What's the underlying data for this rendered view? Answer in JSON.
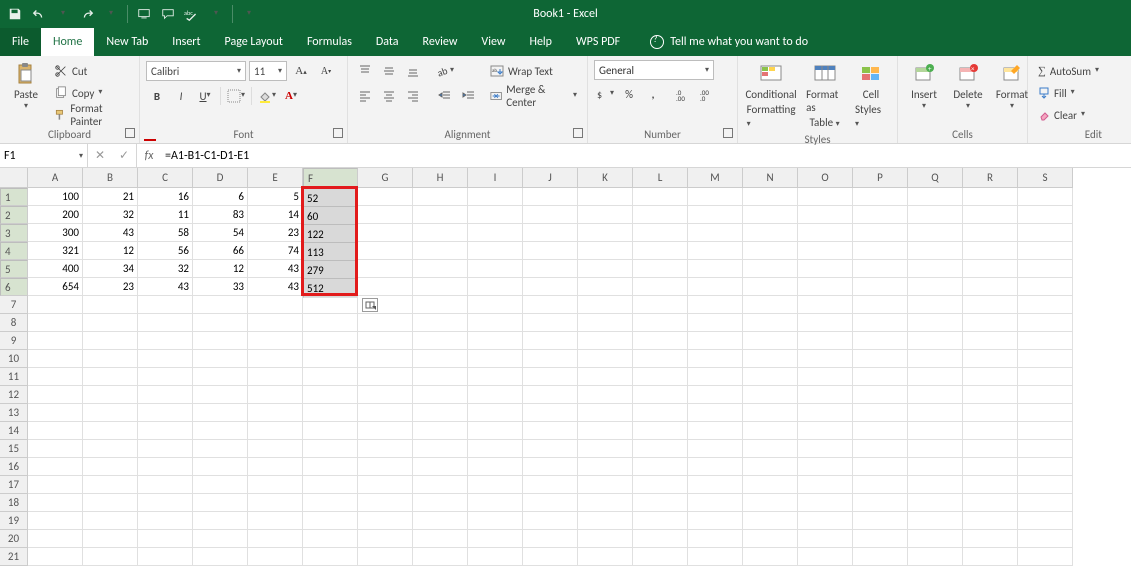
{
  "title": "Book1 - Excel",
  "tabs": [
    "File",
    "Home",
    "New Tab",
    "Insert",
    "Page Layout",
    "Formulas",
    "Data",
    "Review",
    "View",
    "Help",
    "WPS PDF"
  ],
  "tell_me": "Tell me what you want to do",
  "clipboard": {
    "cut": "Cut",
    "copy": "Copy",
    "painter": "Format Painter",
    "paste": "Paste",
    "label": "Clipboard"
  },
  "font": {
    "name": "Calibri",
    "size": "11",
    "label": "Font"
  },
  "alignment": {
    "wrap": "Wrap Text",
    "merge": "Merge & Center",
    "label": "Alignment"
  },
  "number": {
    "format": "General",
    "label": "Number"
  },
  "styles": {
    "cond": "Conditional",
    "cond2": "Formatting",
    "fat": "Format as",
    "fat2": "Table",
    "cs": "Cell",
    "cs2": "Styles",
    "label": "Styles"
  },
  "cells_grp": {
    "insert": "Insert",
    "delete": "Delete",
    "format": "Format",
    "label": "Cells"
  },
  "editing": {
    "autosum": "AutoSum",
    "fill": "Fill",
    "clear": "Clear",
    "label": "Edit"
  },
  "namebox": "F1",
  "formula": "=A1-B1-C1-D1-E1",
  "right_status": "Edit",
  "columns": [
    "A",
    "B",
    "C",
    "D",
    "E",
    "F",
    "G",
    "H",
    "I",
    "J",
    "K",
    "L",
    "M",
    "N",
    "O",
    "P",
    "Q",
    "R",
    "S"
  ],
  "rows": 21,
  "chart_data": {
    "type": "table",
    "columns": [
      "A",
      "B",
      "C",
      "D",
      "E",
      "F"
    ],
    "data": [
      [
        100,
        21,
        16,
        6,
        5,
        52
      ],
      [
        200,
        32,
        11,
        83,
        14,
        60
      ],
      [
        300,
        43,
        58,
        54,
        23,
        122
      ],
      [
        321,
        12,
        56,
        66,
        74,
        113
      ],
      [
        400,
        34,
        32,
        12,
        43,
        279
      ],
      [
        654,
        23,
        43,
        33,
        43,
        512
      ]
    ]
  },
  "selection": {
    "col": "F",
    "row_start": 1,
    "row_end": 6
  }
}
